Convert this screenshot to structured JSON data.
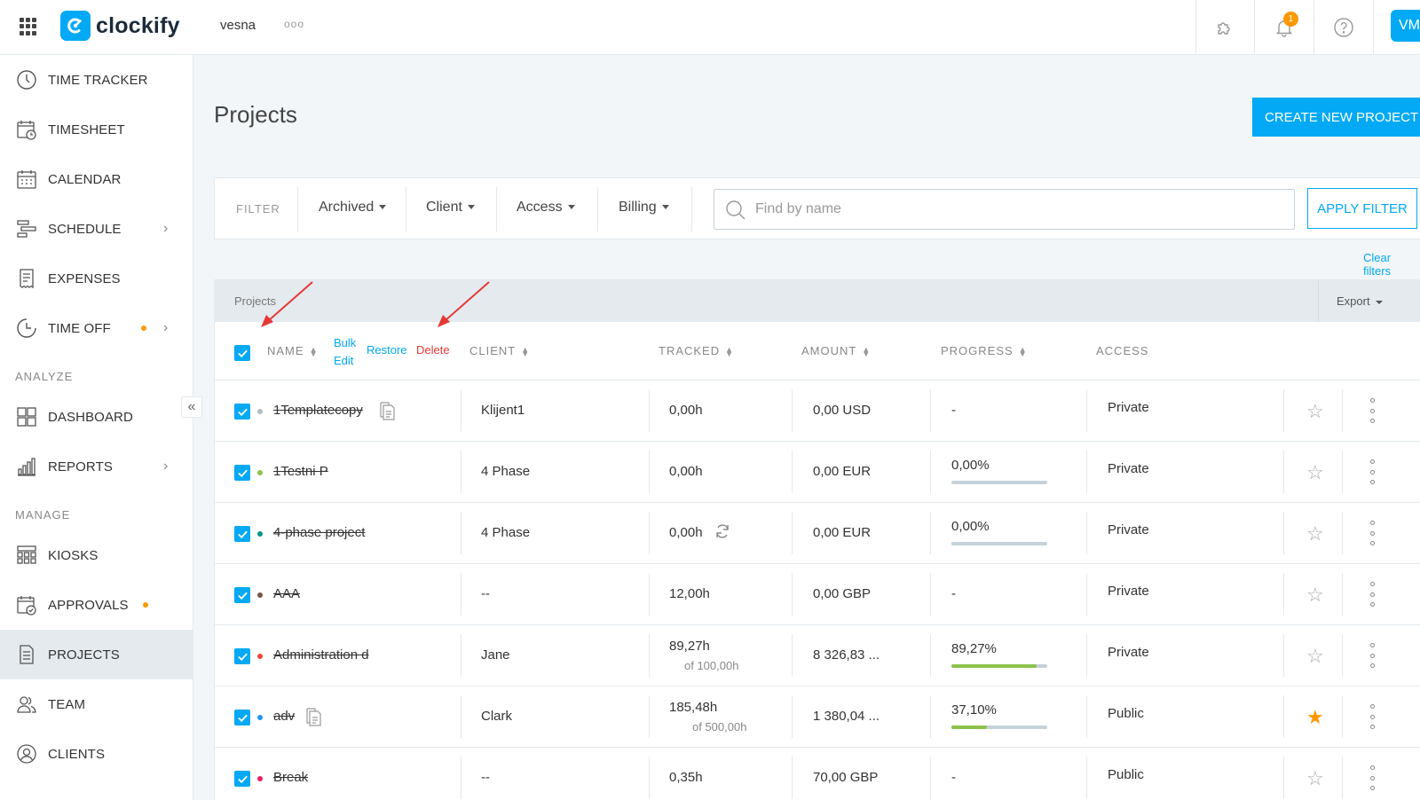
{
  "app": {
    "brand": "clockify",
    "workspace": "vesna",
    "workspace_menu": "ooo",
    "notifications_count": "1",
    "user_initials": "VM"
  },
  "sidebar": {
    "items": [
      {
        "label": "TIME TRACKER"
      },
      {
        "label": "TIMESHEET"
      },
      {
        "label": "CALENDAR"
      },
      {
        "label": "SCHEDULE"
      },
      {
        "label": "EXPENSES"
      },
      {
        "label": "TIME OFF"
      },
      {
        "label": "DASHBOARD"
      },
      {
        "label": "REPORTS"
      },
      {
        "label": "KIOSKS"
      },
      {
        "label": "APPROVALS"
      },
      {
        "label": "PROJECTS"
      },
      {
        "label": "TEAM"
      },
      {
        "label": "CLIENTS"
      }
    ],
    "section_analyze": "ANALYZE",
    "section_manage": "MANAGE",
    "collapse_glyph": "«",
    "chevron_glyph": "›"
  },
  "page": {
    "title": "Projects",
    "create_button": "CREATE NEW PROJECT"
  },
  "filter": {
    "label": "FILTER",
    "archived": "Archived",
    "client": "Client",
    "access": "Access",
    "billing": "Billing",
    "search_placeholder": "Find by name",
    "apply": "APPLY FILTER",
    "clear": "Clear filters"
  },
  "table": {
    "title": "Projects",
    "export": "Export",
    "columns": {
      "name": "NAME",
      "client": "CLIENT",
      "tracked": "TRACKED",
      "amount": "AMOUNT",
      "progress": "PROGRESS",
      "access": "ACCESS"
    },
    "bulk_edit_line1": "Bulk",
    "bulk_edit_line2": "Edit",
    "restore": "Restore",
    "delete": "Delete",
    "rows": [
      {
        "name": "1Templatecopy",
        "dot_color": "#b0bec5",
        "client": "Klijent1",
        "tracked": "0,00h",
        "tracked_sub": "",
        "amount": "0,00 USD",
        "progress": "-",
        "progress_value": null,
        "access": "Private",
        "favorite": false
      },
      {
        "name": "1Testni P",
        "dot_color": "#8bc34a",
        "client": "4 Phase",
        "tracked": "0,00h",
        "tracked_sub": "",
        "amount": "0,00 EUR",
        "progress": "0,00%",
        "progress_value": 0,
        "access": "Private",
        "favorite": false
      },
      {
        "name": "4-phase project",
        "dot_color": "#009688",
        "client": "4 Phase",
        "tracked": "0,00h",
        "tracked_sub": "",
        "amount": "0,00 EUR",
        "progress": "0,00%",
        "progress_value": 0,
        "access": "Private",
        "favorite": false
      },
      {
        "name": "AAA",
        "dot_color": "#795548",
        "client": "--",
        "tracked": "12,00h",
        "tracked_sub": "",
        "amount": "0,00 GBP",
        "progress": "-",
        "progress_value": null,
        "access": "Private",
        "favorite": false
      },
      {
        "name": "Administration d",
        "dot_color": "#f44336",
        "client": "Jane",
        "tracked": "89,27h",
        "tracked_sub": "of 100,00h",
        "amount": "8 326,83 ...",
        "progress": "89,27%",
        "progress_value": 89.27,
        "access": "Private",
        "favorite": false
      },
      {
        "name": "adv",
        "dot_color": "#2196f3",
        "client": "Clark",
        "tracked": "185,48h",
        "tracked_sub": "of 500,00h",
        "amount": "1 380,04 ...",
        "progress": "37,10%",
        "progress_value": 37.1,
        "access": "Public",
        "favorite": true
      },
      {
        "name": "Break",
        "dot_color": "#e91e63",
        "client": "--",
        "tracked": "0,35h",
        "tracked_sub": "",
        "amount": "70,00 GBP",
        "progress": "-",
        "progress_value": null,
        "access": "Public",
        "favorite": false
      }
    ]
  },
  "colors": {
    "accent": "#03a9f4",
    "danger": "#e53935",
    "orange": "#ff9800",
    "progress": "#8bc34a"
  }
}
